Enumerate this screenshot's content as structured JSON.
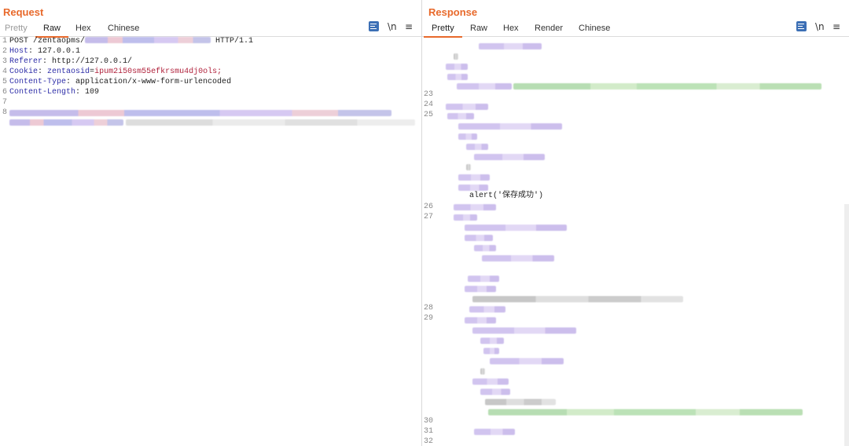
{
  "request": {
    "title": "Request",
    "tabs": [
      "Pretty",
      "Raw",
      "Hex",
      "Chinese"
    ],
    "active_tab": "Raw",
    "tools": {
      "newline_label": "\\n",
      "menu_icon": "menu-icon",
      "wrap_icon": "wrap-lines-icon"
    },
    "lines": [
      {
        "num": "1",
        "method": "POST /zentaopms/",
        "tail": " HTTP/1.1"
      },
      {
        "num": "2",
        "key": "Host",
        "value": "127.0.0.1"
      },
      {
        "num": "3",
        "key": "Referer",
        "value": "http://127.0.0.1/"
      },
      {
        "num": "4",
        "key": "Cookie",
        "ckey": "zentaosid",
        "cval": "ipum2i50sm55efkrsmu4dj0ols;"
      },
      {
        "num": "5",
        "key": "Content-Type",
        "value": "application/x-www-form-urlencoded"
      },
      {
        "num": "6",
        "key": "Content-Length",
        "value": "109"
      },
      {
        "num": "7"
      },
      {
        "num": "8"
      }
    ]
  },
  "response": {
    "title": "Response",
    "tabs": [
      "Pretty",
      "Raw",
      "Hex",
      "Render",
      "Chinese"
    ],
    "active_tab": "Pretty",
    "tools": {
      "newline_label": "\\n",
      "menu_icon": "menu-icon",
      "wrap_icon": "wrap-lines-icon"
    },
    "alert_text": "alert('保存成功')",
    "line_numbers": [
      "23",
      "24",
      "25",
      "26",
      "27",
      "28",
      "29",
      "30",
      "31",
      "32"
    ]
  },
  "layout_toggle": {
    "icons": [
      "split-columns-icon",
      "split-rows-icon",
      "single-pane-icon"
    ],
    "active": "split-columns-icon"
  },
  "colors": {
    "accent": "#e8692b",
    "header_key": "#2e2ea8",
    "cookie_value": "#b0213b",
    "string": "#2a8a2a",
    "icon_blue": "#3c6fb5"
  }
}
